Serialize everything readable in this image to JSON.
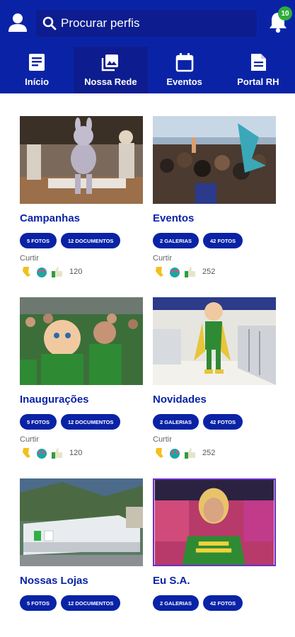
{
  "header": {
    "search_placeholder": "Procurar perfis",
    "notification_count": "10"
  },
  "tabs": [
    {
      "label": "Início"
    },
    {
      "label": "Nossa Rede"
    },
    {
      "label": "Eventos"
    },
    {
      "label": "Portal RH"
    }
  ],
  "cards": [
    {
      "title": "Campanhas",
      "chip1": "5 FOTOS",
      "chip2": "12 DOCUMENTOS",
      "like_label": "Curtir",
      "reactions": "120"
    },
    {
      "title": "Eventos",
      "chip1": "2 GALERIAS",
      "chip2": "42 FOTOS",
      "like_label": "Curtir",
      "reactions": "252"
    },
    {
      "title": "Inaugurações",
      "chip1": "5 FOTOS",
      "chip2": "12 DOCUMENTOS",
      "like_label": "Curtir",
      "reactions": "120"
    },
    {
      "title": "Novidades",
      "chip1": "2 GALERIAS",
      "chip2": "42 FOTOS",
      "like_label": "Curtir",
      "reactions": "252"
    },
    {
      "title": "Nossas Lojas",
      "chip1": "5 FOTOS",
      "chip2": "12 DOCUMENTOS"
    },
    {
      "title": "Eu S.A.",
      "chip1": "2 GALERIAS",
      "chip2": "42 FOTOS"
    }
  ],
  "colors": {
    "primary": "#0a23a6",
    "badge": "#2fae3a"
  }
}
